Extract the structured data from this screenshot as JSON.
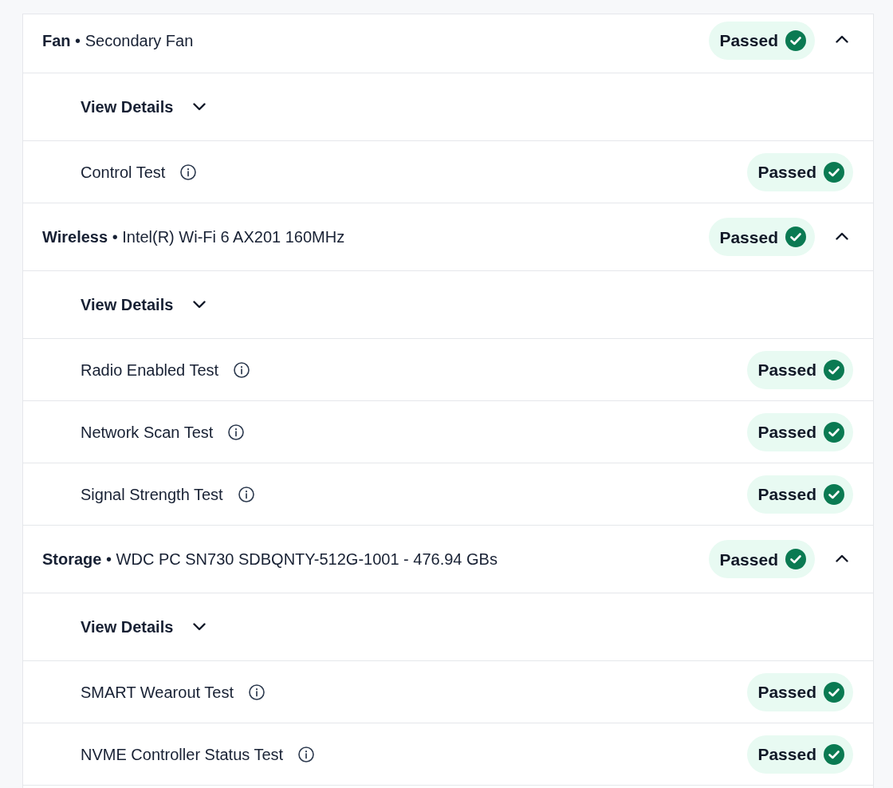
{
  "sections": [
    {
      "title": "**Fan** • Secondary Fan",
      "status": "Passed",
      "expanded": true,
      "details": {
        "label": "View Details",
        "expanded": false
      },
      "tests": [
        {
          "name": "Control Test",
          "status": "Passed"
        }
      ]
    },
    {
      "title": "**Wireless** • Intel(R) Wi-Fi 6 AX201 160MHz",
      "status": "Passed",
      "expanded": true,
      "details": {
        "label": "View Details",
        "expanded": false
      },
      "tests": [
        {
          "name": "Radio Enabled Test",
          "status": "Passed"
        },
        {
          "name": "Network Scan Test",
          "status": "Passed"
        },
        {
          "name": "Signal Strength Test",
          "status": "Passed"
        }
      ]
    },
    {
      "title": "**Storage** • WDC PC SN730 SDBQNTY-512G-1001 - 476.94 GBs",
      "status": "Passed",
      "expanded": true,
      "details": {
        "label": "View Details",
        "expanded": false
      },
      "tests": [
        {
          "name": "SMART Wearout Test",
          "status": "Passed"
        },
        {
          "name": "NVME Controller Status Test",
          "status": "Passed"
        }
      ]
    }
  ]
}
